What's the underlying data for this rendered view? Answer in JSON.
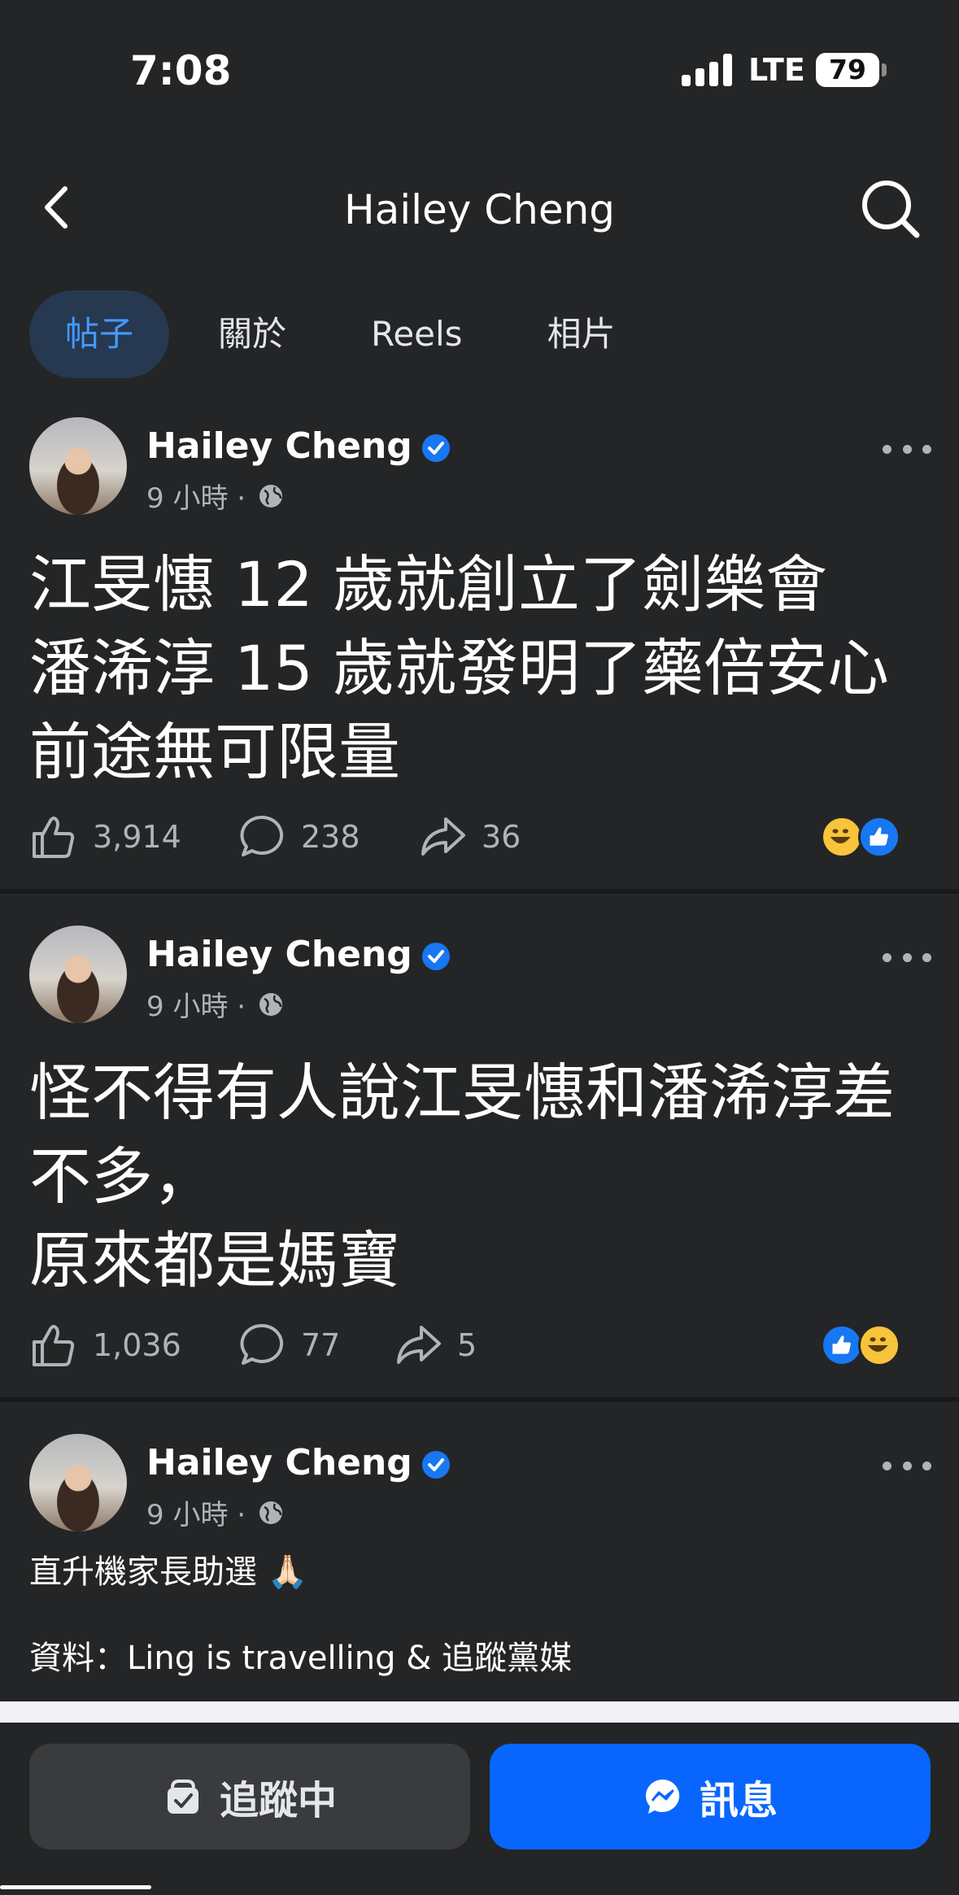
{
  "status_bar": {
    "time": "7:08",
    "network": "LTE",
    "battery": "79"
  },
  "header": {
    "title": "Hailey Cheng"
  },
  "tabs": [
    {
      "label": "帖子",
      "active": true
    },
    {
      "label": "關於",
      "active": false
    },
    {
      "label": "Reels",
      "active": false
    },
    {
      "label": "相片",
      "active": false
    }
  ],
  "posts": [
    {
      "author": "Hailey Cheng",
      "time": "9 小時 ·",
      "text": "江旻憓 12 歲就創立了劍樂會\n潘浠淳 15 歲就發明了藥倍安心\n前途無可限量",
      "likes": "3,914",
      "comments": "238",
      "shares": "36",
      "reactions": [
        "haha",
        "like"
      ]
    },
    {
      "author": "Hailey Cheng",
      "time": "9 小時 ·",
      "text": "怪不得有人說江旻憓和潘浠淳差不多，\n原來都是媽寶",
      "likes": "1,036",
      "comments": "77",
      "shares": "5",
      "reactions": [
        "like",
        "haha"
      ]
    },
    {
      "author": "Hailey Cheng",
      "time": "9 小時 ·",
      "text_line1": "直升機家長助選 🙏🏻",
      "text_line2": "資料：Ling is travelling & 追蹤黨媒"
    }
  ],
  "bottom_bar": {
    "following_label": "追蹤中",
    "message_label": "訊息"
  },
  "colors": {
    "background": "#242526",
    "accent": "#0866ff",
    "tab_active_bg": "#263951",
    "tab_active_text": "#4599ff"
  }
}
